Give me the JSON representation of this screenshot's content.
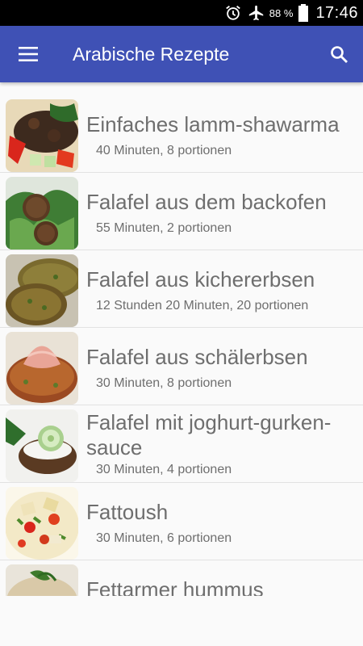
{
  "status_bar": {
    "battery_percent": "88 %",
    "time": "17:46",
    "icons": [
      "alarm-icon",
      "airplane-mode-icon",
      "battery-icon"
    ]
  },
  "app_bar": {
    "title": "Arabische Rezepte",
    "menu_icon": "hamburger-menu-icon",
    "search_icon": "search-icon",
    "color": "#3f51b5"
  },
  "recipes": [
    {
      "title": "Einfaches lamm-shawarma",
      "meta": "40 Minuten, 8 portionen"
    },
    {
      "title": "Falafel aus dem backofen",
      "meta": "55 Minuten, 2 portionen"
    },
    {
      "title": "Falafel aus kichererbsen",
      "meta": "12 Stunden 20 Minuten, 20 portionen"
    },
    {
      "title": "Falafel aus schälerbsen",
      "meta": "30 Minuten, 8 portionen"
    },
    {
      "title": "Falafel mit joghurt-gurken-sauce",
      "meta": "30 Minuten, 4 portionen"
    },
    {
      "title": "Fattoush",
      "meta": "30 Minuten, 6 portionen"
    },
    {
      "title": "Fettarmer hummus",
      "meta": ""
    }
  ]
}
